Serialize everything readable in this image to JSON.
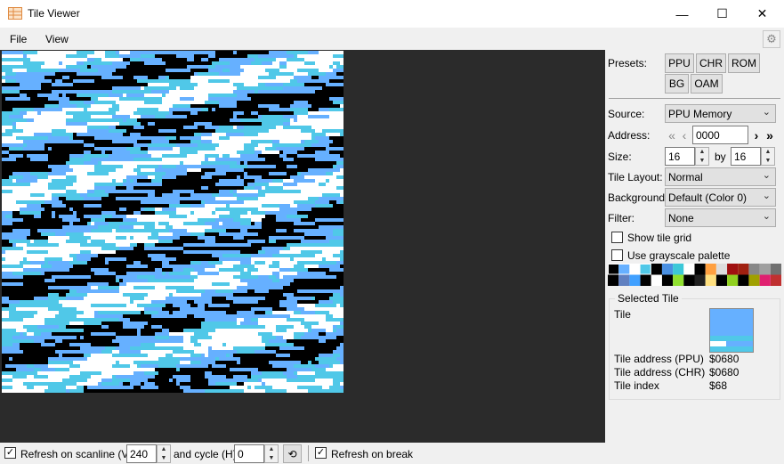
{
  "window": {
    "title": "Tile Viewer",
    "minimize_glyph": "—",
    "maximize_glyph": "☐",
    "close_glyph": "✕"
  },
  "menu": {
    "file": "File",
    "view": "View"
  },
  "presets": {
    "label": "Presets:",
    "buttons": [
      "PPU",
      "CHR",
      "ROM",
      "BG",
      "OAM"
    ]
  },
  "source": {
    "label": "Source:",
    "value": "PPU Memory"
  },
  "address": {
    "label": "Address:",
    "value": "0000"
  },
  "size": {
    "label": "Size:",
    "width": "16",
    "by": "by",
    "height": "16"
  },
  "tile_layout": {
    "label": "Tile Layout:",
    "value": "Normal"
  },
  "background": {
    "label": "Background:",
    "value": "Default (Color 0)"
  },
  "filter": {
    "label": "Filter:",
    "value": "None"
  },
  "options": {
    "show_tile_grid": {
      "label": "Show tile grid",
      "checked": false
    },
    "grayscale": {
      "label": "Use grayscale palette",
      "checked": false
    }
  },
  "palette_colors": [
    "#000000",
    "#66b0ff",
    "#ffffff",
    "#50c8e8",
    "#000000",
    "#4a90e2",
    "#3cc8d8",
    "#ffffff",
    "#000000",
    "#ffa040",
    "#dddddd",
    "#a01010",
    "#a02010",
    "#888888",
    "#a0a0a0",
    "#707070",
    "#000000",
    "#6080c0",
    "#40a0ff",
    "#000000",
    "#ffffff",
    "#000000",
    "#90e030",
    "#000000",
    "#202020",
    "#ffe080",
    "#000000",
    "#90d020",
    "#000000",
    "#a0a000",
    "#e02070",
    "#c03030"
  ],
  "selected_tile": {
    "legend": "Selected Tile",
    "tile_label": "Tile",
    "rows": [
      {
        "label": "Tile address (PPU)",
        "value": "$0680"
      },
      {
        "label": "Tile address (CHR)",
        "value": "$0680"
      },
      {
        "label": "Tile index",
        "value": "$68"
      }
    ]
  },
  "statusbar": {
    "refresh_scanline": {
      "label": "Refresh on scanline (V)",
      "checked": true,
      "value": "240"
    },
    "cycle": {
      "label": "and cycle (H)",
      "value": "0"
    },
    "refresh_break": {
      "label": "Refresh on break",
      "checked": true
    }
  },
  "colors": {
    "tile_dark": "#000000",
    "tile_light": "#66b0ff",
    "tile_cyan": "#50c8e8",
    "tile_white": "#ffffff"
  }
}
